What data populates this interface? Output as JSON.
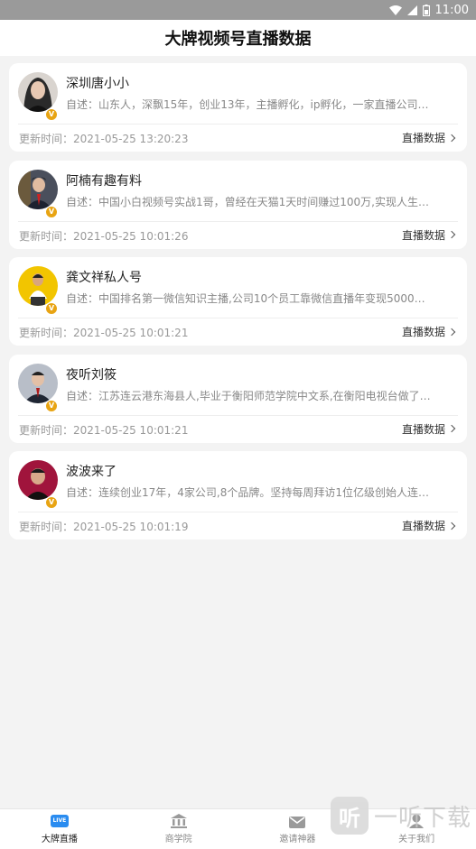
{
  "status_bar": {
    "time": "11:00"
  },
  "header": {
    "title": "大牌视频号直播数据"
  },
  "cards": [
    {
      "name": "深圳唐小小",
      "desc": "自述：山东人，深飘15年，创业13年，主播孵化，ip孵化，一家直播公司…",
      "time": "更新时间：2021-05-25 13:20:23",
      "link": "直播数据",
      "avatar_color": "#3a3a3a"
    },
    {
      "name": "阿楠有趣有料",
      "desc": "自述：中国小白视频号实战1哥，曾经在天猫1天时间赚过100万,实现人生…",
      "time": "更新时间：2021-05-25 10:01:26",
      "link": "直播数据",
      "avatar_color": "#2b2f3a"
    },
    {
      "name": "龚文祥私人号",
      "desc": "自述：中国排名第一微信知识主播,公司10个员工靠微信直播年变现5000…",
      "time": "更新时间：2021-05-25 10:01:21",
      "link": "直播数据",
      "avatar_color": "#f2c500"
    },
    {
      "name": "夜听刘筱",
      "desc": "自述：江苏连云港东海县人,毕业于衡阳师范学院中文系,在衡阳电视台做了…",
      "time": "更新时间：2021-05-25 10:01:21",
      "link": "直播数据",
      "avatar_color": "#8e96a3"
    },
    {
      "name": "波波来了",
      "desc": "自述：连续创业17年，4家公司,8个品牌。坚持每周拜访1位亿级创始人连…",
      "time": "更新时间：2021-05-25 10:01:19",
      "link": "直播数据",
      "avatar_color": "#a0143c"
    }
  ],
  "tabs": [
    {
      "label": "大牌直播",
      "icon": "live-icon",
      "icon_text": "LIVE",
      "active": true
    },
    {
      "label": "商学院",
      "icon": "building-icon",
      "active": false
    },
    {
      "label": "邀请神器",
      "icon": "mail-icon",
      "active": false
    },
    {
      "label": "关于我们",
      "icon": "person-icon",
      "active": false
    }
  ],
  "watermark": {
    "badge": "听",
    "text": "一听下载"
  }
}
